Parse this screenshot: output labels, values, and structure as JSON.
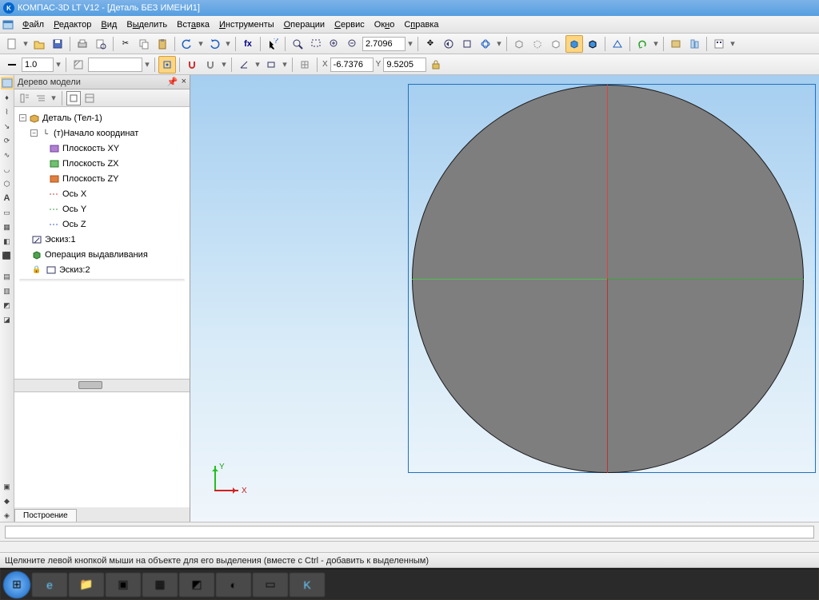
{
  "titlebar": {
    "text": "КОМПАС-3D LT V12 - [Деталь БЕЗ ИМЕНИ1]"
  },
  "menu": {
    "file": "Файл",
    "editor": "Редактор",
    "view": "Вид",
    "select": "Выделить",
    "insert": "Вставка",
    "tools": "Инструменты",
    "operations": "Операции",
    "service": "Сервис",
    "window": "Окно",
    "help": "Справка"
  },
  "toolbar2": {
    "scale": "1.0",
    "style": "",
    "zoom_val": "2.7096",
    "coord_x": "-6.7376",
    "coord_y": "9.5205",
    "x_label": "X",
    "y_label": "Y"
  },
  "sidebar": {
    "title": "Дерево модели",
    "nodes": {
      "root": "Деталь (Тел-1)",
      "origin": "(т)Начало координат",
      "plane_xy": "Плоскость XY",
      "plane_zx": "Плоскость ZX",
      "plane_zy": "Плоскость ZY",
      "axis_x": "Ось X",
      "axis_y": "Ось Y",
      "axis_z": "Ось Z",
      "sketch1": "Эскиз:1",
      "extrude": "Операция выдавливания",
      "sketch2": "Эскиз:2"
    },
    "tab": "Построение"
  },
  "viewport": {
    "axis_x": "X",
    "axis_y": "Y"
  },
  "status": {
    "hint": "Щелкните левой кнопкой мыши на объекте для его выделения (вместе с Ctrl - добавить к выделенным)"
  }
}
